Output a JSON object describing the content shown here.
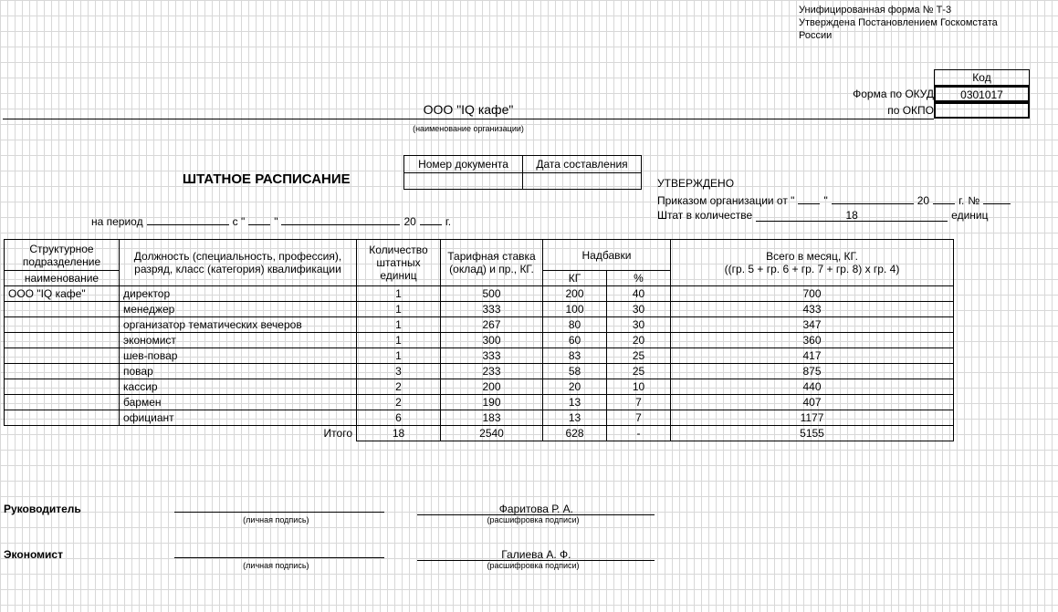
{
  "form_note": {
    "line1": "Унифицированная форма № Т-3",
    "line2": "Утверждена Постановлением Госкомстата",
    "line3": "России"
  },
  "code": {
    "header": "Код",
    "okud_label": "Форма по ОКУД",
    "okud_value": "0301017",
    "okpo_label": "по ОКПО",
    "okpo_value": ""
  },
  "org": {
    "name": "ООО \"IQ кафе\"",
    "caption": "(наименование организации)"
  },
  "title": "ШТАТНОЕ РАСПИСАНИЕ",
  "docnum": {
    "h1": "Номер документа",
    "h2": "Дата составления",
    "v1": "",
    "v2": ""
  },
  "approve": {
    "title": "УТВЕРЖДЕНО",
    "order_prefix": "Приказом организации от \"",
    "order_mid": "\"",
    "year_prefix": "20",
    "year_suffix": "г.",
    "num_prefix": "№",
    "staff_label": "Штат в количестве",
    "staff_value": "18",
    "staff_unit": "единиц"
  },
  "period": {
    "label": "на период",
    "from": "с \"",
    "from_close": "\"",
    "year_prefix": "20",
    "year_suffix": "г."
  },
  "headers": {
    "subd": "Структурное подразделение",
    "subd_sub": "наименование",
    "job": "Должность (специальность, профессия), разряд, класс (категория) квалификации",
    "units": "Количество штатных единиц",
    "tariff": "Тарифная ставка (оклад) и пр., КГ.",
    "allow": "Надбавки",
    "allow_kg": "КГ",
    "allow_pct": "%",
    "total": "Всего в месяц, КГ.",
    "total_formula": "((гр. 5 + гр. 6 + гр. 7 + гр. 8) x гр. 4)"
  },
  "subd_name": "ООО \"IQ кафе\"",
  "rows": [
    {
      "job": "директор",
      "units": "1",
      "tariff": "500",
      "kg": "200",
      "pct": "40",
      "total": "700"
    },
    {
      "job": "менеджер",
      "units": "1",
      "tariff": "333",
      "kg": "100",
      "pct": "30",
      "total": "433"
    },
    {
      "job": "организатор тематических вечеров",
      "units": "1",
      "tariff": "267",
      "kg": "80",
      "pct": "30",
      "total": "347"
    },
    {
      "job": "экономист",
      "units": "1",
      "tariff": "300",
      "kg": "60",
      "pct": "20",
      "total": "360"
    },
    {
      "job": "шев-повар",
      "units": "1",
      "tariff": "333",
      "kg": "83",
      "pct": "25",
      "total": "417"
    },
    {
      "job": "повар",
      "units": "3",
      "tariff": "233",
      "kg": "58",
      "pct": "25",
      "total": "875"
    },
    {
      "job": "кассир",
      "units": "2",
      "tariff": "200",
      "kg": "20",
      "pct": "10",
      "total": "440"
    },
    {
      "job": "бармен",
      "units": "2",
      "tariff": "190",
      "kg": "13",
      "pct": "7",
      "total": "407"
    },
    {
      "job": "официант",
      "units": "6",
      "tariff": "183",
      "kg": "13",
      "pct": "7",
      "total": "1177"
    }
  ],
  "totals": {
    "label": "Итого",
    "units": "18",
    "tariff": "2540",
    "kg": "628",
    "pct": "-",
    "total": "5155"
  },
  "sign": {
    "role1": "Руководитель",
    "role2": "Экономист",
    "sig_caption": "(личная подпись)",
    "name_caption": "(расшифровка подписи)",
    "name1": "Фаритова Р. А.",
    "name2": "Галиева А. Ф."
  }
}
